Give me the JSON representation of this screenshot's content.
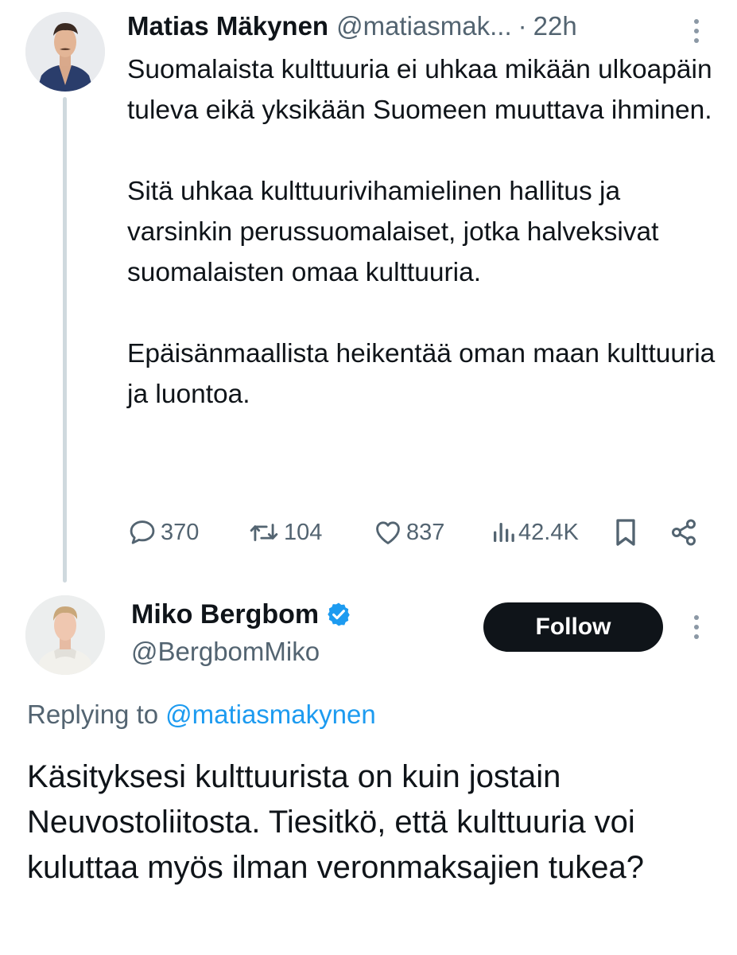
{
  "parent_tweet": {
    "author_name": "Matias Mäkynen",
    "author_handle": "@matiasmak...",
    "separator": "·",
    "time_ago": "22h",
    "paragraphs": [
      "Suomalaista kulttuuria ei uhkaa mikään ulkoapäin tuleva eikä yksikään Suomeen muuttava ihminen.",
      "Sitä uhkaa kulttuurivihamielinen hallitus ja varsinkin perussuomalaiset, jotka halveksivat suomalaisten omaa kulttuuria.",
      "Epäisänmaallista heikentää oman maan kulttuuria ja luontoa."
    ],
    "stats": {
      "replies": "370",
      "reposts": "104",
      "likes": "837",
      "views": "42.4K"
    }
  },
  "reply_tweet": {
    "author_name": "Miko Bergbom",
    "author_handle": "@BergbomMiko",
    "verified": true,
    "follow_label": "Follow",
    "replying_prefix": "Replying to",
    "replying_handle": "@matiasmakynen",
    "text": "Käsityksesi kulttuurista on kuin jostain Neuvostoliitosta. Tiesitkö, että kulttuuria voi kuluttaa myös ilman veronmaksajien tukea?"
  },
  "icons": {
    "reply": "speech-bubble-icon",
    "repost": "repost-arrows-icon",
    "like": "heart-icon",
    "views": "bar-chart-icon",
    "bookmark": "bookmark-icon",
    "share": "share-icon",
    "more": "vertical-dots-icon",
    "verified": "verified-badge-icon"
  },
  "colors": {
    "text": "#0f1419",
    "secondary": "#536471",
    "link": "#1d9bf0",
    "follow_button": "#0f1419",
    "thread_line": "#cfd9de"
  }
}
